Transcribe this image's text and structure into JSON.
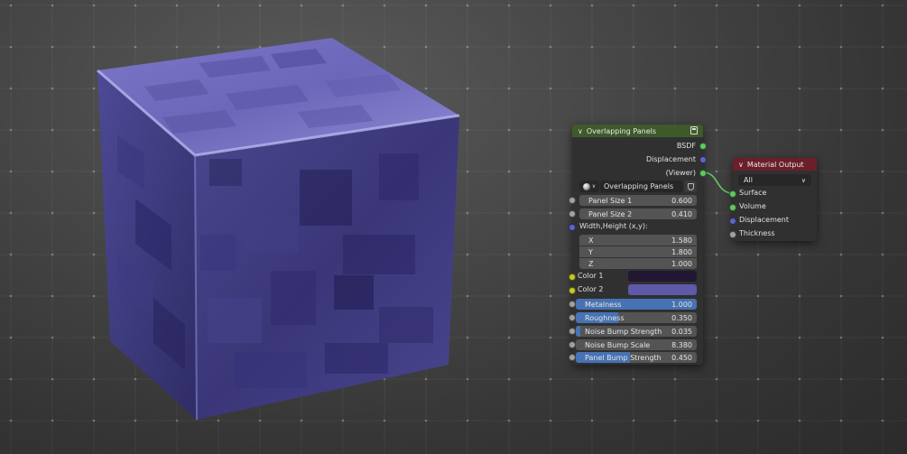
{
  "colors": {
    "group_header": "#3f5a2a",
    "output_header": "#6b1f2b",
    "node_body": "#303030",
    "field": "#545454",
    "highlight": "#4772b3",
    "socket_shader": "#63c763",
    "socket_vector": "#6363c7",
    "socket_float": "#a1a1a1",
    "socket_color": "#c7c729",
    "color1": "#221733",
    "color2": "#5e59a8",
    "link": "#63c763"
  },
  "group_node": {
    "title": "Overlapping Panels",
    "outputs": [
      {
        "label": "BSDF",
        "socket": "shader"
      },
      {
        "label": "Displacement",
        "socket": "vector"
      },
      {
        "label": "(Viewer)",
        "socket": "shader"
      }
    ],
    "datablock": "Overlapping Panels",
    "inputs": {
      "panel_size_1": {
        "label": "Panel Size 1",
        "value": "0.600"
      },
      "panel_size_2": {
        "label": "Panel Size 2",
        "value": "0.410"
      },
      "width_height": {
        "label": "Width,Height (x,y):"
      },
      "x": {
        "label": "X",
        "value": "1.580"
      },
      "y": {
        "label": "Y",
        "value": "1.800"
      },
      "z": {
        "label": "Z",
        "value": "1.000"
      },
      "color1": {
        "label": "Color 1"
      },
      "color2": {
        "label": "Color 2"
      },
      "metalness": {
        "label": "Metalness",
        "value": "1.000",
        "fraction": 1.0
      },
      "roughness": {
        "label": "Roughness",
        "value": "0.350",
        "fraction": 0.35
      },
      "noise_bump_strength": {
        "label": "Noise Bump Strength",
        "value": "0.035",
        "fraction": 0.035
      },
      "noise_bump_scale": {
        "label": "Noise Bump Scale",
        "value": "8.380"
      },
      "panel_bump_strength": {
        "label": "Panel Bump Strength",
        "value": "0.450",
        "fraction": 0.45
      }
    }
  },
  "output_node": {
    "title": "Material Output",
    "target": "All",
    "inputs": [
      {
        "label": "Surface",
        "socket": "shader"
      },
      {
        "label": "Volume",
        "socket": "shader"
      },
      {
        "label": "Displacement",
        "socket": "vector"
      },
      {
        "label": "Thickness",
        "socket": "float"
      }
    ]
  },
  "icons": {
    "collapse": "chevron-down-icon",
    "node_group": "node-group-icon",
    "material": "material-sphere-icon",
    "fake_user": "shield-icon",
    "dropdown": "chevron-down-icon"
  }
}
